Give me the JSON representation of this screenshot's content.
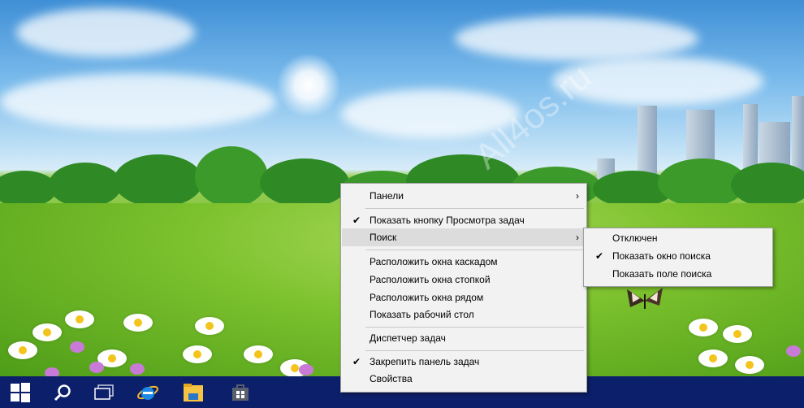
{
  "context_menu": {
    "items": [
      {
        "label": "Панели",
        "checked": false,
        "submenu": true
      },
      {
        "label": "Показать кнопку Просмотра задач",
        "checked": true,
        "submenu": false
      },
      {
        "label": "Поиск",
        "checked": false,
        "submenu": true,
        "highlighted": true
      },
      {
        "label": "Расположить окна каскадом",
        "checked": false,
        "submenu": false
      },
      {
        "label": "Расположить окна стопкой",
        "checked": false,
        "submenu": false
      },
      {
        "label": "Расположить окна рядом",
        "checked": false,
        "submenu": false
      },
      {
        "label": "Показать рабочий стол",
        "checked": false,
        "submenu": false
      },
      {
        "label": "Диспетчер задач",
        "checked": false,
        "submenu": false
      },
      {
        "label": "Закрепить панель задач",
        "checked": true,
        "submenu": false
      },
      {
        "label": "Свойства",
        "checked": false,
        "submenu": false
      }
    ],
    "check_glyph": "✔",
    "arrow_glyph": "›"
  },
  "search_submenu": {
    "items": [
      {
        "label": "Отключен",
        "checked": false
      },
      {
        "label": "Показать окно поиска",
        "checked": true
      },
      {
        "label": "Показать поле поиска",
        "checked": false
      }
    ]
  },
  "desktop": {
    "watermark": "All4os.ru",
    "wallpaper": "green meadow with flowers, blue sky and city skyline"
  },
  "taskbar": {
    "background": "#0c1f6b",
    "buttons": [
      {
        "name": "start-button",
        "icon": "windows-logo-icon"
      },
      {
        "name": "search-button",
        "icon": "search-icon"
      },
      {
        "name": "task-view-button",
        "icon": "task-view-icon"
      },
      {
        "name": "internet-explorer-button",
        "icon": "internet-explorer-icon"
      },
      {
        "name": "file-explorer-button",
        "icon": "folder-icon"
      },
      {
        "name": "store-button",
        "icon": "store-icon"
      }
    ]
  },
  "colors": {
    "menu_bg": "#f2f2f2",
    "menu_highlight": "#dcdcdc",
    "ie_blue": "#1e88e5",
    "folder_yellow": "#f6c343"
  }
}
